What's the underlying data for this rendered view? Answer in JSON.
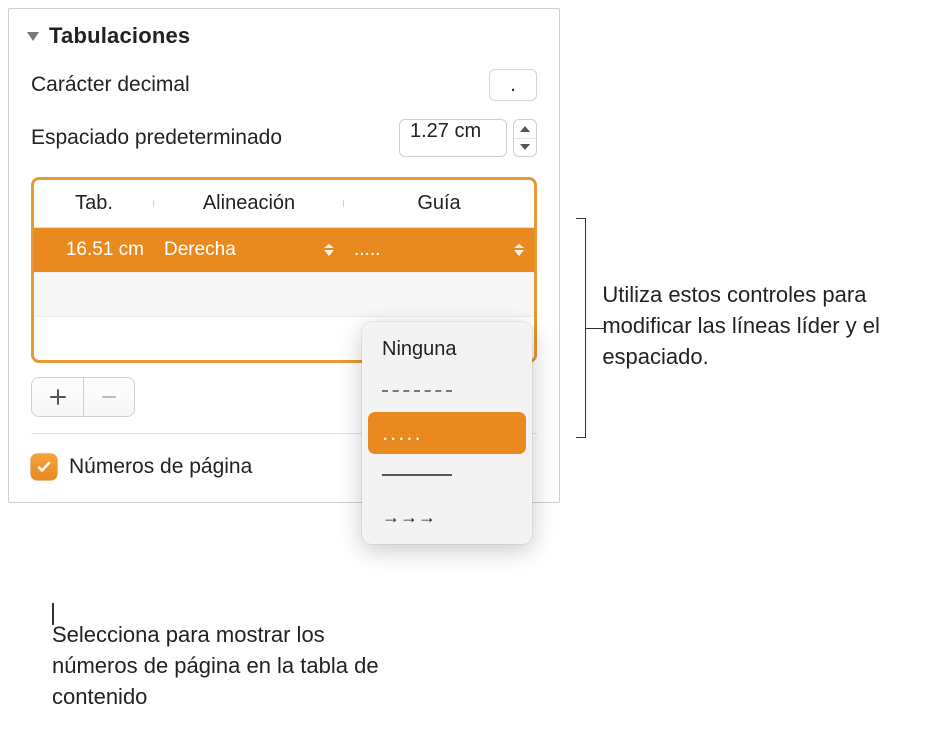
{
  "section": {
    "title": "Tabulaciones"
  },
  "decimal": {
    "label": "Carácter decimal",
    "value": "."
  },
  "spacing": {
    "label": "Espaciado predeterminado",
    "value": "1.27 cm"
  },
  "table": {
    "headers": {
      "tab": "Tab.",
      "align": "Alineación",
      "guide": "Guía"
    },
    "row": {
      "tab": "16.51 cm",
      "align": "Derecha",
      "guide": "....."
    }
  },
  "dropdown": {
    "none": "Ninguna",
    "dashes": "- - - - -",
    "dots": ".....",
    "arrows": "→→→"
  },
  "checkbox": {
    "label": "Números de página",
    "checked": true
  },
  "callouts": {
    "right": "Utiliza estos controles para modificar las líneas líder y el espaciado.",
    "bottom": "Selecciona para mostrar los números de página en la tabla de contenido"
  }
}
